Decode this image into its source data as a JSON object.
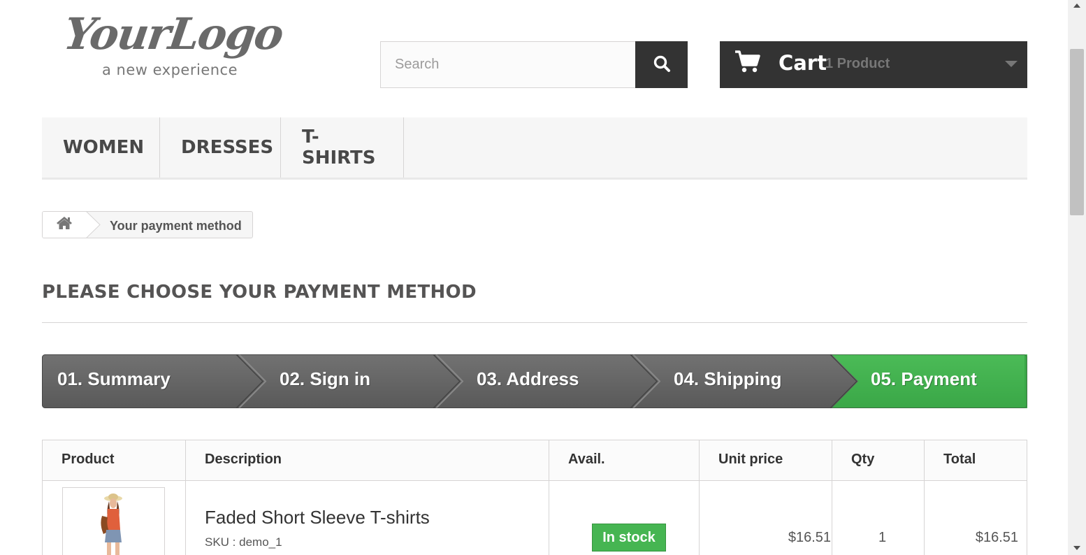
{
  "logo": {
    "main": "YourLogo",
    "tagline": "a new experience"
  },
  "search": {
    "placeholder": "Search",
    "icon": "search-icon"
  },
  "cart": {
    "title": "Cart",
    "count": "1 Product",
    "icon": "cart-icon",
    "caret_icon": "caret-down-icon"
  },
  "nav": {
    "items": [
      {
        "label": "Women"
      },
      {
        "label": "Dresses"
      },
      {
        "label": "T-shirts"
      }
    ]
  },
  "breadcrumb": {
    "home_icon": "home-icon",
    "current": "Your payment method"
  },
  "page_heading": "Please choose your payment method",
  "steps": [
    {
      "label": "01. Summary",
      "state": "done"
    },
    {
      "label": "02. Sign in",
      "state": "done"
    },
    {
      "label": "03. Address",
      "state": "done"
    },
    {
      "label": "04. Shipping",
      "state": "done"
    },
    {
      "label": "05. Payment",
      "state": "current"
    }
  ],
  "colors": {
    "step_done": "#666666",
    "step_current": "#46b552",
    "dark": "#333333",
    "in_stock": "#46b552"
  },
  "table": {
    "headers": [
      "Product",
      "Description",
      "Avail.",
      "Unit price",
      "Qty",
      "Total"
    ],
    "rows": [
      {
        "name": "Faded Short Sleeve T-shirts",
        "sku": "SKU : demo_1",
        "availability": "In stock",
        "unit_price": "$16.51",
        "qty": "1",
        "total": "$16.51"
      }
    ]
  }
}
